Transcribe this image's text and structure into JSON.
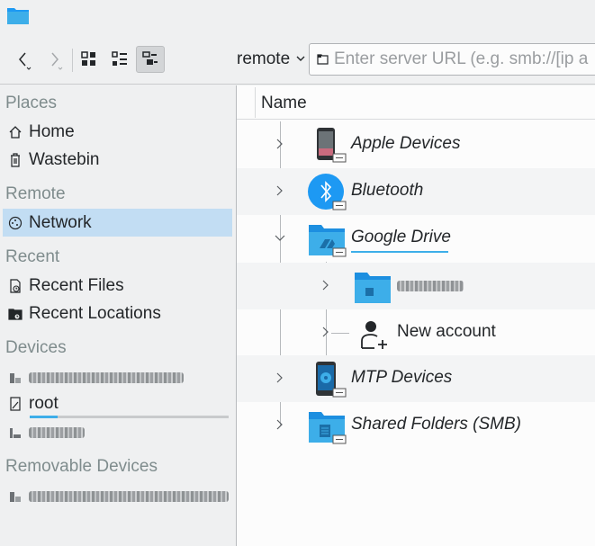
{
  "toolbar": {
    "location_label": "remote",
    "url_placeholder": "Enter server URL (e.g. smb://[ip a"
  },
  "sidebar": {
    "sections": {
      "places": "Places",
      "remote": "Remote",
      "recent": "Recent",
      "devices": "Devices",
      "removable": "Removable Devices"
    },
    "items": {
      "home": "Home",
      "wastebin": "Wastebin",
      "network": "Network",
      "recent_files": "Recent Files",
      "recent_locations": "Recent Locations",
      "root": "root"
    },
    "root_usage_fraction": 0.14
  },
  "view": {
    "column_header": "Name",
    "rows": [
      {
        "label": "Apple Devices",
        "icon": "phone-icon"
      },
      {
        "label": "Bluetooth",
        "icon": "bluetooth-icon"
      },
      {
        "label": "Google Drive",
        "icon": "google-drive-folder-icon"
      },
      {
        "label": "New account",
        "icon": "add-user-icon"
      },
      {
        "label": "MTP Devices",
        "icon": "mtp-device-icon"
      },
      {
        "label": "Shared Folders (SMB)",
        "icon": "smb-folder-icon"
      }
    ]
  },
  "colors": {
    "accent": "#3daee9",
    "selection": "#c2ddf3",
    "folder_blue": "#1d99f3"
  }
}
